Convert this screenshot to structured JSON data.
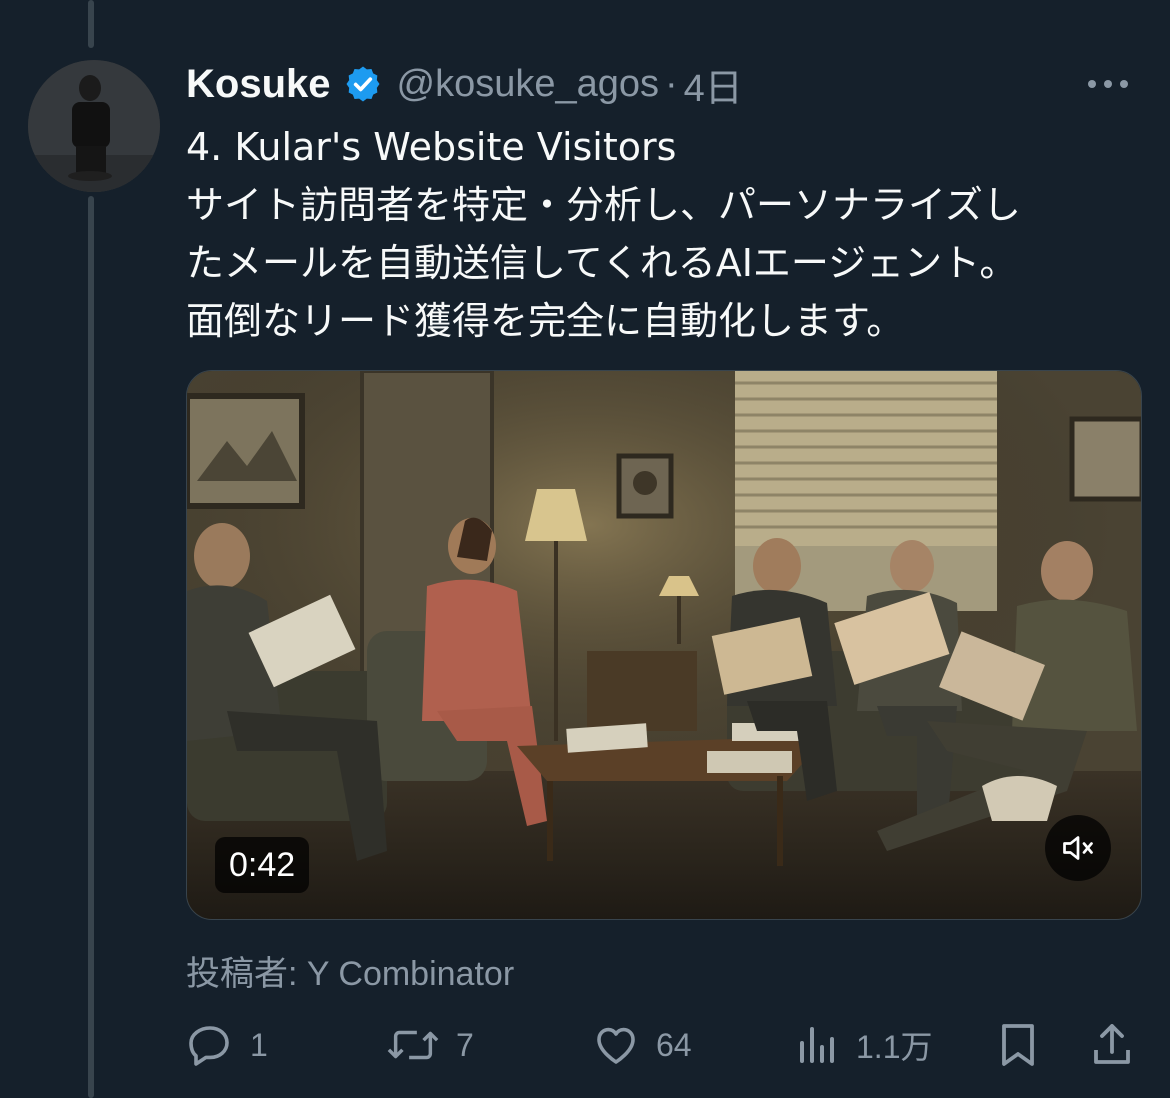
{
  "author": {
    "name": "Kosuke",
    "handle": "@kosuke_agos",
    "separator": "·",
    "time": "4日"
  },
  "tweet": {
    "lines": [
      "4. Kular's Website Visitors",
      "サイト訪問者を特定・分析し、パーソナライズし",
      "たメールを自動送信してくれるAIエージェント。",
      "面倒なリード獲得を完全に自動化します。"
    ]
  },
  "media": {
    "duration": "0:42"
  },
  "attribution": "投稿者: Y Combinator",
  "actions": {
    "replies": "1",
    "reposts": "7",
    "likes": "64",
    "views": "1.1万"
  },
  "icons": {
    "verified": "verified-badge-icon",
    "more": "more-dots-icon",
    "mute": "volume-muted-icon",
    "reply": "reply-icon",
    "repost": "repost-icon",
    "like": "heart-icon",
    "views": "analytics-icon",
    "bookmark": "bookmark-icon",
    "share": "share-icon"
  },
  "colors": {
    "background": "#15202b",
    "text": "#f7f9f9",
    "muted": "#8b98a5",
    "verified": "#1d9bf0"
  }
}
